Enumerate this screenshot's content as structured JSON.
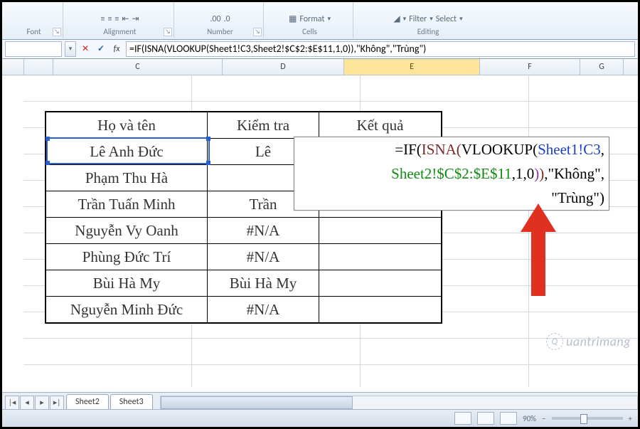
{
  "ribbon": {
    "groups": [
      {
        "label": "Font"
      },
      {
        "label": "Alignment"
      },
      {
        "label": "Number"
      },
      {
        "label": "Cells",
        "item": "Format"
      },
      {
        "label": "Editing",
        "items": [
          "Filter",
          "Select"
        ]
      }
    ]
  },
  "formula_bar": {
    "name_box": "",
    "formula": "=IF(ISNA(VLOOKUP(Sheet1!C3,Sheet2!$C$2:$E$11,1,0)),\"Không\",\"Trùng\")"
  },
  "columns": [
    "C",
    "D",
    "E",
    "F",
    "G"
  ],
  "active_column": "E",
  "table": {
    "headers": {
      "C": "Họ và tên",
      "D": "Kiểm tra",
      "E": "Kết quả"
    },
    "rows": [
      {
        "C": "Lê Anh Đức",
        "D": "Lê"
      },
      {
        "C": "Phạm Thu Hà",
        "D": ""
      },
      {
        "C": "Trần Tuấn Minh",
        "D": "Trần"
      },
      {
        "C": "Nguyễn Vy Oanh",
        "D": "#N/A"
      },
      {
        "C": "Phùng Đức Trí",
        "D": "#N/A"
      },
      {
        "C": "Bùi Hà My",
        "D": "Bùi Hà My"
      },
      {
        "C": "Nguyễn Minh Đức",
        "D": "#N/A"
      }
    ]
  },
  "cell_formula": {
    "line1_a": "=IF(",
    "line1_b": "ISNA(",
    "line1_c": "VLOOKUP(",
    "line1_d": "Sheet1!C3",
    "line1_e": ",",
    "line2_a": "Sheet2!$C$2:$E$11",
    "line2_b": ",1,0",
    "line2_c": ")",
    "line2_d": ")",
    "line2_e": ",\"Không\",",
    "line3_a": "\"Trùng\"",
    "line3_b": ")"
  },
  "sheet_tabs": [
    "Sheet2",
    "Sheet3"
  ],
  "status": {
    "zoom": "90%",
    "zoom_minus": "−",
    "zoom_plus": "+"
  },
  "watermark": "uantrimang"
}
